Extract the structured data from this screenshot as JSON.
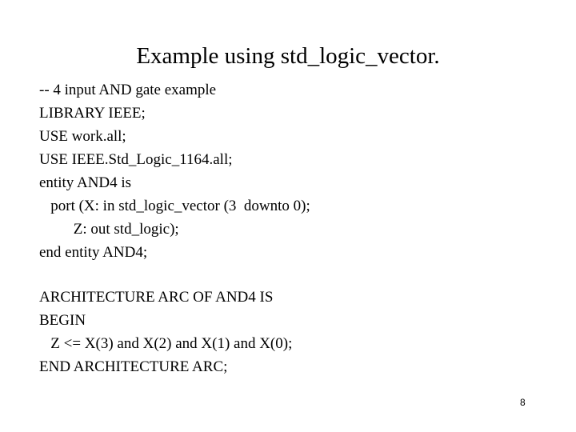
{
  "slide": {
    "title": "Example using std_logic_vector.",
    "lines": [
      "-- 4 input AND gate example",
      "LIBRARY IEEE;",
      "USE work.all;",
      "USE IEEE.Std_Logic_1164.all;",
      "entity AND4 is",
      "   port (X: in std_logic_vector (3  downto 0);",
      "         Z: out std_logic);",
      "end entity AND4;",
      "ARCHITECTURE ARC OF AND4 IS",
      "BEGIN",
      "   Z <= X(3) and X(2) and X(1) and X(0);",
      "END ARCHITECTURE ARC;"
    ],
    "page_number": "8"
  }
}
